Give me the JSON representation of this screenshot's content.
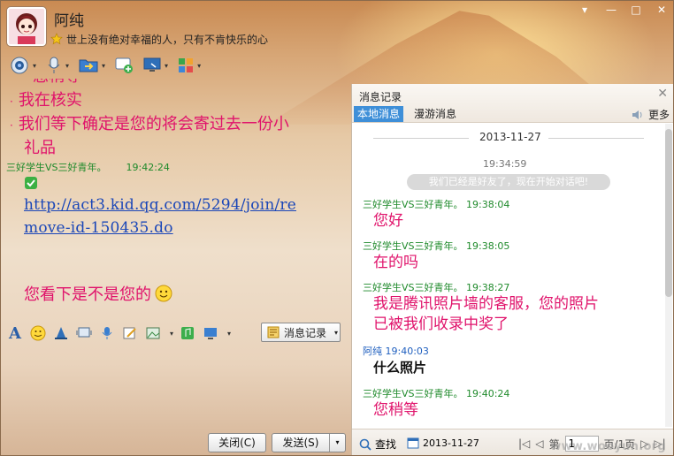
{
  "header": {
    "contact_name": "阿纯",
    "signature": "世上没有绝对幸福的人，只有不肯快乐的心"
  },
  "window_buttons": {
    "menu": "▾",
    "minimize": "—",
    "maximize": "□",
    "close": "✕"
  },
  "chat": {
    "lines_top": [
      "我在核实",
      "我们等下确定是您的将会寄过去一份小"
    ],
    "line_cont": "礼品",
    "partial_top": "您稍等",
    "msg_sender": "三好学生VS三好青年。",
    "msg_time": "19:42:24",
    "link_line1": "http://act3.kid.qq.com/5294/join/re",
    "link_line2": "move-id-150435.do",
    "last_message": "您看下是不是您的"
  },
  "input_toolbar": {
    "history_button_label": "消息记录"
  },
  "buttons": {
    "close_label": "关闭(C)",
    "send_label": "发送(S)"
  },
  "history": {
    "title": "消息记录",
    "tab_local": "本地消息",
    "tab_roam": "漫游消息",
    "more_label": "更多",
    "date": "2013-11-27",
    "time": "19:34:59",
    "system_message": "我们已经是好友了，现在开始对话吧!",
    "entries": [
      {
        "sender": "三好学生VS三好青年。",
        "time": "19:38:04",
        "text": "您好"
      },
      {
        "sender": "三好学生VS三好青年。",
        "time": "19:38:05",
        "text": "在的吗"
      },
      {
        "sender": "三好学生VS三好青年。",
        "time": "19:38:27",
        "text": "我是腾讯照片墙的客服，您的照片"
      },
      {
        "sender": "",
        "time": "",
        "text": "已被我们收录中奖了"
      },
      {
        "sender": "阿纯",
        "time": "19:40:03",
        "text": "什么照片"
      },
      {
        "sender": "三好学生VS三好青年。",
        "time": "19:40:24",
        "text": "您稍等"
      }
    ],
    "footer": {
      "search_label": "查找",
      "date_value": "2013-11-27",
      "page_prefix": "第",
      "page_value": "1",
      "page_suffix": "页/1页"
    }
  },
  "watermark": "www.wooyun.org",
  "colors": {
    "incoming_text": "#e0136b",
    "sender_green": "#1f8a2b",
    "sender_blue": "#1f5fbf",
    "link_blue": "#1a46b8",
    "tab_active": "#3e8fd8"
  }
}
